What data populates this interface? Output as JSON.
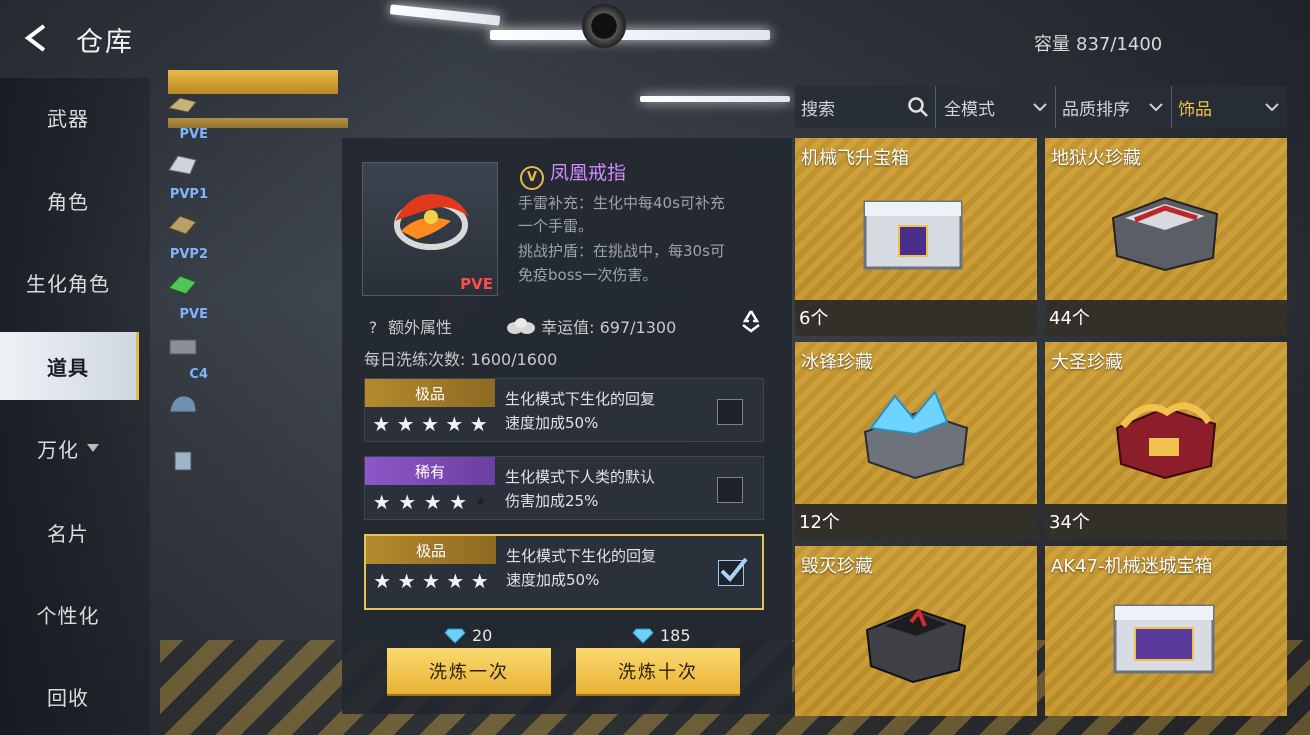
{
  "header": {
    "title": "仓库",
    "capacity_label": "容量",
    "capacity_value": "837/1400"
  },
  "nav": {
    "items": [
      {
        "label": "武器",
        "active": false
      },
      {
        "label": "角色",
        "active": false
      },
      {
        "label": "生化角色",
        "active": false
      },
      {
        "label": "道具",
        "active": true
      },
      {
        "label": "万化",
        "active": false
      },
      {
        "label": "名片",
        "active": false
      },
      {
        "label": "个性化",
        "active": false
      },
      {
        "label": "回收",
        "active": false
      }
    ]
  },
  "sub_categories": [
    {
      "label": "PVE"
    },
    {
      "label": "PVP1"
    },
    {
      "label": "PVP2"
    },
    {
      "label": "PVE"
    },
    {
      "label": "C4"
    },
    {
      "label": ""
    },
    {
      "label": ""
    }
  ],
  "detail": {
    "item_name": "凤凰戒指",
    "badge_letter": "V",
    "mode_tag": "PVE",
    "desc_line1": "手雷补充：生化中每40s可补充",
    "desc_line2": "一个手雷。",
    "desc_line3": "挑战护盾：在挑战中，每30s可",
    "desc_line4": "免疫boss一次伤害。",
    "extra_label": "额外属性",
    "extra_q": "?",
    "luck_label": "幸运值:",
    "luck_value": "697/1300",
    "daily_label": "每日洗练次数:",
    "daily_value": "1600/1600",
    "attributes": [
      {
        "grade": "极品",
        "grade_type": "epic",
        "stars": 5,
        "line1": "生化模式下生化的回复",
        "line2": "速度加成50%",
        "checked": false,
        "selected": false
      },
      {
        "grade": "稀有",
        "grade_type": "rare",
        "stars": 4,
        "line1": "生化模式下人类的默认",
        "line2": "伤害加成25%",
        "checked": false,
        "selected": false
      },
      {
        "grade": "极品",
        "grade_type": "epic",
        "stars": 5,
        "line1": "生化模式下生化的回复",
        "line2": "速度加成50%",
        "checked": true,
        "selected": true
      }
    ],
    "cost_once": "20",
    "cost_ten": "185",
    "btn_once": "洗炼一次",
    "btn_ten": "洗炼十次"
  },
  "filters": {
    "search_placeholder": "搜索",
    "mode": "全模式",
    "sort": "品质排序",
    "category": "饰品"
  },
  "grid_items": [
    {
      "name": "机械飞升宝箱",
      "count": "6个",
      "icon": "purple-chest-icon"
    },
    {
      "name": "地狱火珍藏",
      "count": "44个",
      "icon": "hellfire-chest-icon"
    },
    {
      "name": "冰锋珍藏",
      "count": "12个",
      "icon": "ice-chest-icon"
    },
    {
      "name": "大圣珍藏",
      "count": "34个",
      "icon": "monkey-king-chest-icon"
    },
    {
      "name": "毁灭珍藏",
      "count": "",
      "icon": "destruction-chest-icon"
    },
    {
      "name": "AK47-机械迷城宝箱",
      "count": "",
      "icon": "ak47-chest-icon"
    }
  ],
  "colors": {
    "accent_gold": "#e8b84a",
    "epic": "#b58a2d",
    "rare": "#8e56c9",
    "item_name": "#cf8cff",
    "pve": "#ff4b4b"
  }
}
